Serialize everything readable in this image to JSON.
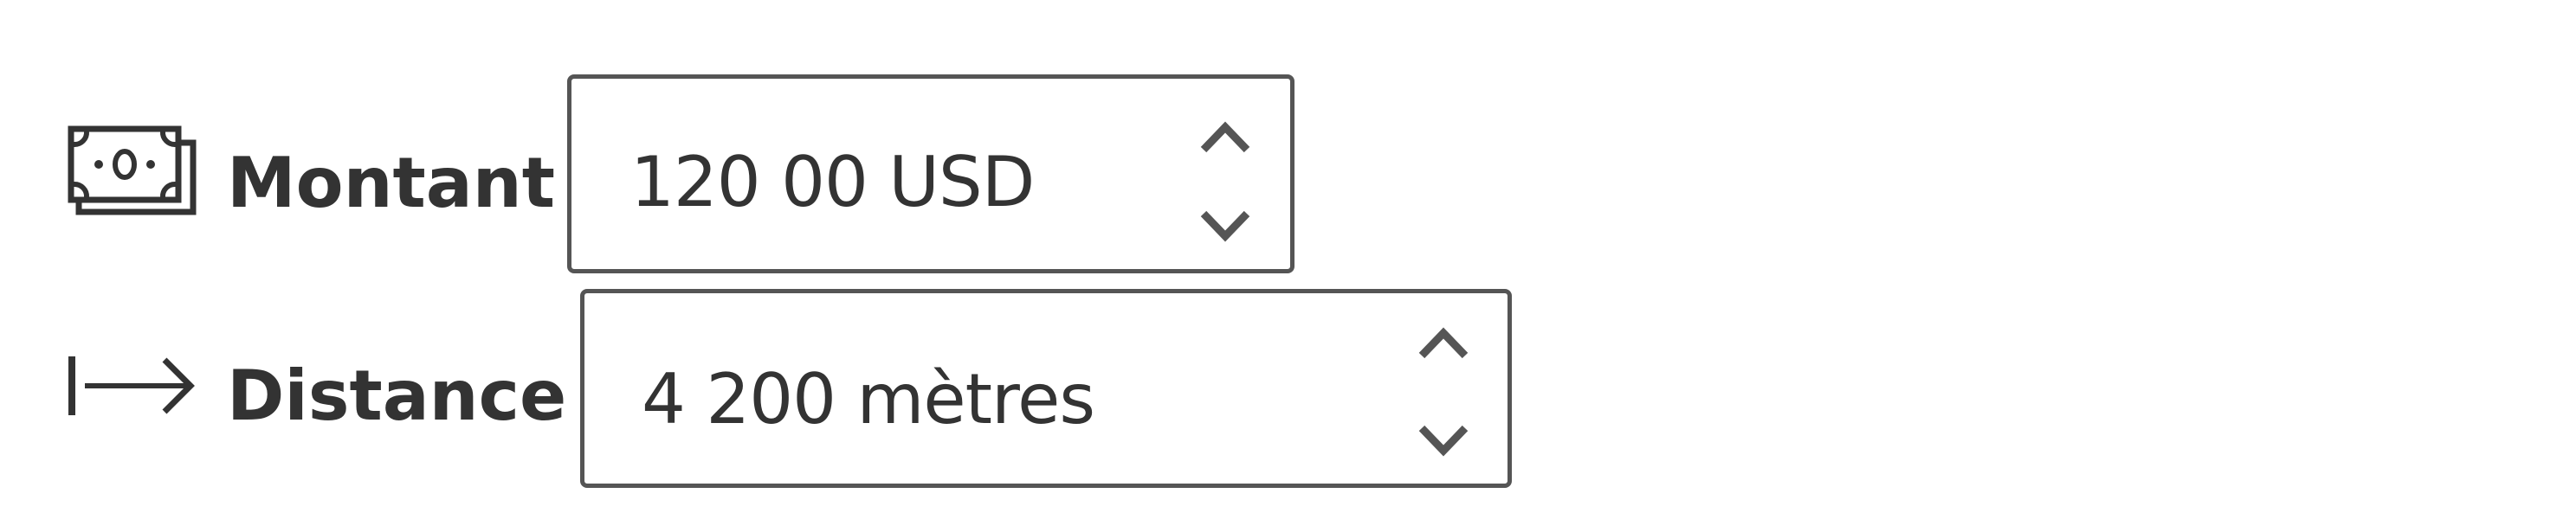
{
  "fields": [
    {
      "icon": "banknote-icon",
      "label": "Montant",
      "value": "120 00 USD"
    },
    {
      "icon": "arrow-right-from-bar-icon",
      "label": "Distance",
      "value": "4 200 mètres"
    }
  ],
  "colors": {
    "text": "#333333",
    "border": "#555555",
    "chevron": "#555555",
    "background": "#ffffff"
  }
}
